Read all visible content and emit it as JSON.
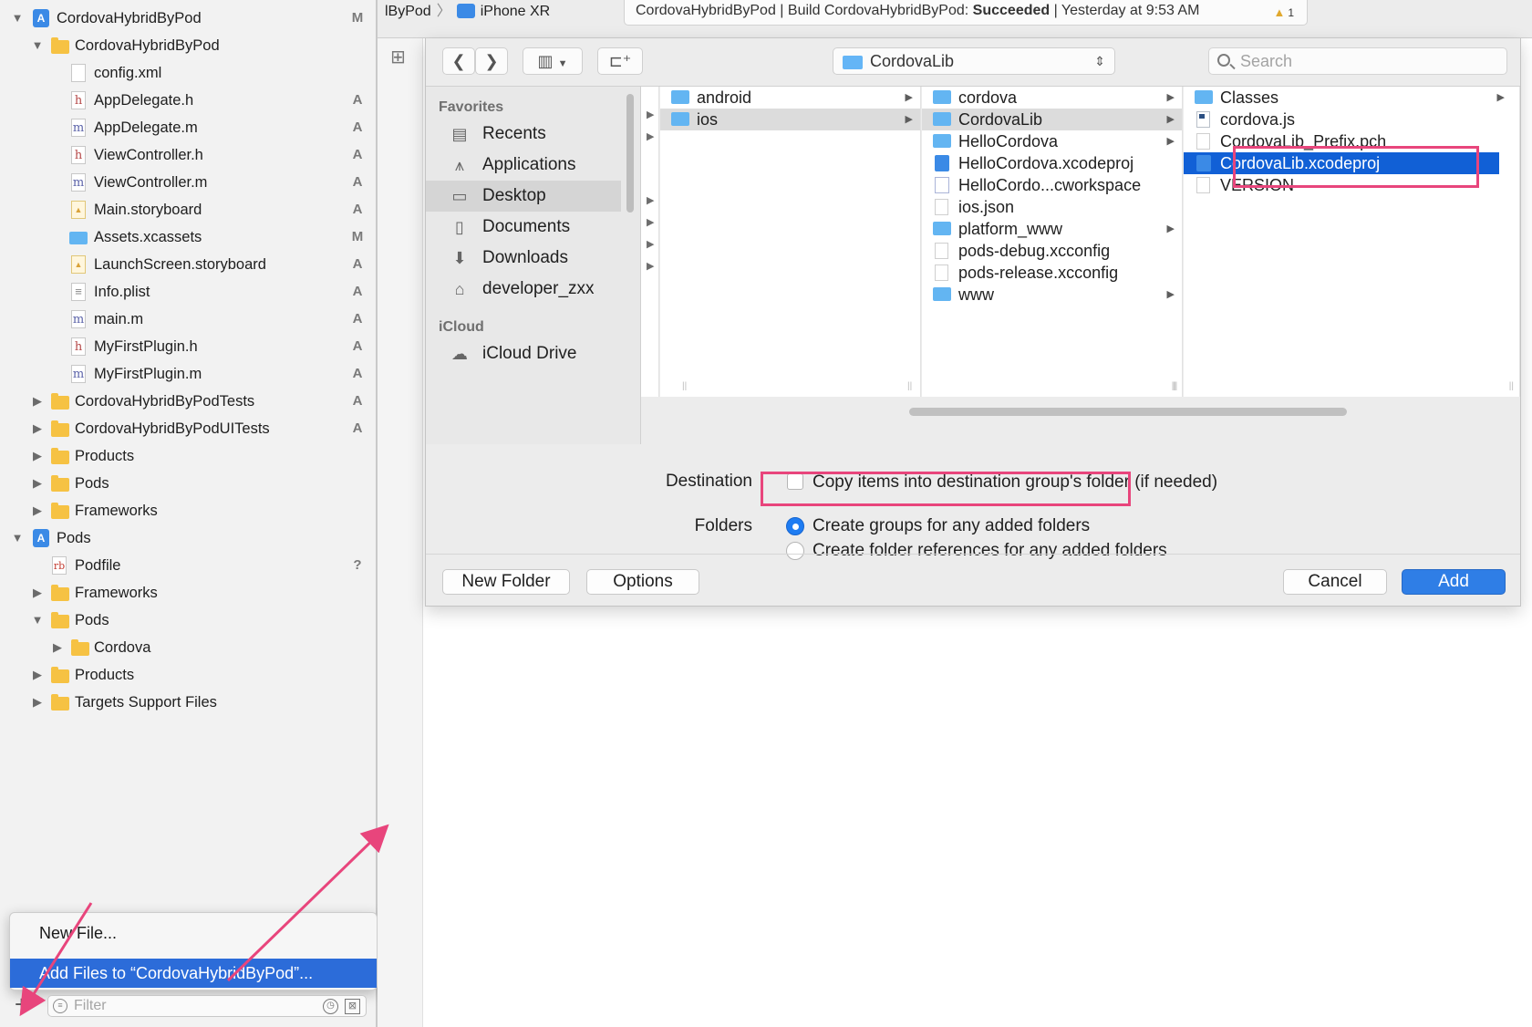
{
  "navigator": {
    "rows": [
      {
        "label": "CordovaHybridByPod",
        "status": "M"
      },
      {
        "label": "CordovaHybridByPod",
        "status": ""
      },
      {
        "label": "config.xml",
        "status": ""
      },
      {
        "label": "AppDelegate.h",
        "status": "A"
      },
      {
        "label": "AppDelegate.m",
        "status": "A"
      },
      {
        "label": "ViewController.h",
        "status": "A"
      },
      {
        "label": "ViewController.m",
        "status": "A"
      },
      {
        "label": "Main.storyboard",
        "status": "A"
      },
      {
        "label": "Assets.xcassets",
        "status": "M"
      },
      {
        "label": "LaunchScreen.storyboard",
        "status": "A"
      },
      {
        "label": "Info.plist",
        "status": "A"
      },
      {
        "label": "main.m",
        "status": "A"
      },
      {
        "label": "MyFirstPlugin.h",
        "status": "A"
      },
      {
        "label": "MyFirstPlugin.m",
        "status": "A"
      },
      {
        "label": "CordovaHybridByPodTests",
        "status": "A"
      },
      {
        "label": "CordovaHybridByPodUITests",
        "status": "A"
      },
      {
        "label": "Products",
        "status": ""
      },
      {
        "label": "Pods",
        "status": ""
      },
      {
        "label": "Frameworks",
        "status": ""
      },
      {
        "label": "Pods",
        "status": ""
      },
      {
        "label": "Podfile",
        "status": "?"
      },
      {
        "label": "Frameworks",
        "status": ""
      },
      {
        "label": "Pods",
        "status": ""
      },
      {
        "label": "Cordova",
        "status": ""
      },
      {
        "label": "Products",
        "status": ""
      },
      {
        "label": "Targets Support Files",
        "status": ""
      }
    ],
    "menu": {
      "new_file": "New File...",
      "add_files": "Add Files to “CordovaHybridByPod”..."
    },
    "filter_placeholder": "Filter",
    "add_symbol": "+"
  },
  "toolbar": {
    "scheme_fragment": "lByPod",
    "device": "iPhone XR",
    "status_prefix": "CordovaHybridByPod | Build CordovaHybridByPod:",
    "status_result": "Succeeded",
    "status_suffix": "| Yesterday at 9:53 AM",
    "warning_count": "1"
  },
  "sheet": {
    "path_popup": "CordovaLib",
    "search_placeholder": "Search",
    "sidebar": {
      "favorites_header": "Favorites",
      "favorites": [
        "Recents",
        "Applications",
        "Desktop",
        "Documents",
        "Downloads",
        "developer_zxx"
      ],
      "icloud_header": "iCloud",
      "icloud": [
        "iCloud Drive"
      ]
    },
    "columns": [
      {
        "items": [
          "android",
          "ios"
        ]
      },
      {
        "items": [
          "cordova",
          "CordovaLib",
          "HelloCordova",
          "HelloCordova.xcodeproj",
          "HelloCordo...cworkspace",
          "ios.json",
          "platform_www",
          "pods-debug.xcconfig",
          "pods-release.xcconfig",
          "www"
        ]
      },
      {
        "items": [
          "Classes",
          "cordova.js",
          "CordovaLib_Prefix.pch",
          "CordovaLib.xcodeproj",
          "VERSION"
        ]
      }
    ],
    "destination_label": "Destination",
    "copy_items_text": "Copy items into destination group's folder (if needed)",
    "folders_label": "Folders",
    "folders_option_groups": "Create groups for any added folders",
    "folders_option_refs": "Create folder references for any added folders",
    "buttons": {
      "new_folder": "New Folder",
      "options": "Options",
      "cancel": "Cancel",
      "add": "Add"
    }
  },
  "colors": {
    "selection_blue": "#1160d6",
    "primary_button": "#2f7ee6",
    "annotation_pink": "#e8457c",
    "folder_yellow": "#f6c243",
    "folder_blue": "#63b5f2"
  }
}
